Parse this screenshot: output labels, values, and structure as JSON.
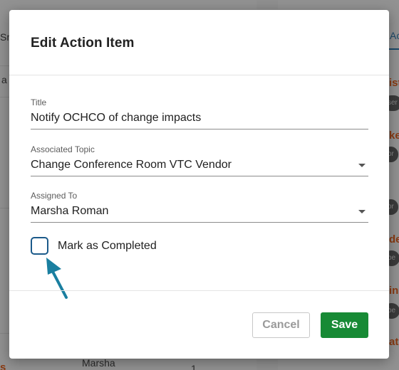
{
  "modal": {
    "title": "Edit Action Item",
    "fields": {
      "title": {
        "label": "Title",
        "value": "Notify OCHCO of change impacts"
      },
      "topic": {
        "label": "Associated Topic",
        "value": "Change Conference Room VTC Vendor"
      },
      "assigned": {
        "label": "Assigned To",
        "value": "Marsha Roman"
      }
    },
    "checkbox": {
      "label": "Mark as Completed",
      "checked": false
    },
    "buttons": {
      "cancel": "Cancel",
      "save": "Save"
    }
  },
  "background": {
    "left_fragments": [
      "Sm",
      "a",
      "Marsha",
      "1",
      "s"
    ],
    "right_tab": "Ac",
    "right_orange": [
      "ist",
      "ke",
      "de",
      "ing",
      "ate"
    ],
    "right_chips": [
      "ser",
      "or",
      "or",
      "be",
      "be",
      "be"
    ]
  },
  "colors": {
    "accent": "#1b5a8a",
    "save": "#178a35",
    "arrow": "#1a7fa0"
  }
}
